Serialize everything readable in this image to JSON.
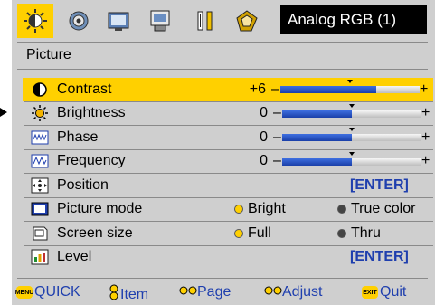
{
  "source": "Analog RGB (1)",
  "section_title": "Picture",
  "tabs": [
    {
      "icon": "picture-icon"
    },
    {
      "icon": "audio-icon"
    },
    {
      "icon": "display-icon"
    },
    {
      "icon": "setup-icon"
    },
    {
      "icon": "features-icon"
    },
    {
      "icon": "options-icon"
    }
  ],
  "rows": [
    {
      "label": "Contrast",
      "value": "+6",
      "level": 0.69,
      "icon": "contrast-icon"
    },
    {
      "label": "Brightness",
      "value": "0",
      "level": 0.5,
      "icon": "brightness-icon"
    },
    {
      "label": "Phase",
      "value": "0",
      "level": 0.5,
      "icon": "phase-icon"
    },
    {
      "label": "Frequency",
      "value": "0",
      "level": 0.5,
      "icon": "frequency-icon"
    },
    {
      "label": "Position",
      "action": "[ENTER]",
      "icon": "position-icon"
    },
    {
      "label": "Picture mode",
      "option1": "Bright",
      "option2": "True color",
      "icon": "picture-mode-icon"
    },
    {
      "label": "Screen size",
      "option1": "Full",
      "option2": "Thru",
      "icon": "screen-size-icon"
    },
    {
      "label": "Level",
      "action": "[ENTER]",
      "icon": "level-icon"
    }
  ],
  "bar_minus": "–",
  "bar_plus": "+",
  "footer": {
    "quick": "QUICK",
    "quick_badge": "MENU",
    "item": "Item",
    "page": "Page",
    "adjust": "Adjust",
    "quit": "Quit",
    "quit_badge": "EXIT"
  },
  "colors": {
    "highlight": "#ffd000",
    "panel": "#cfcfcf",
    "accent": "#1f3fae"
  }
}
